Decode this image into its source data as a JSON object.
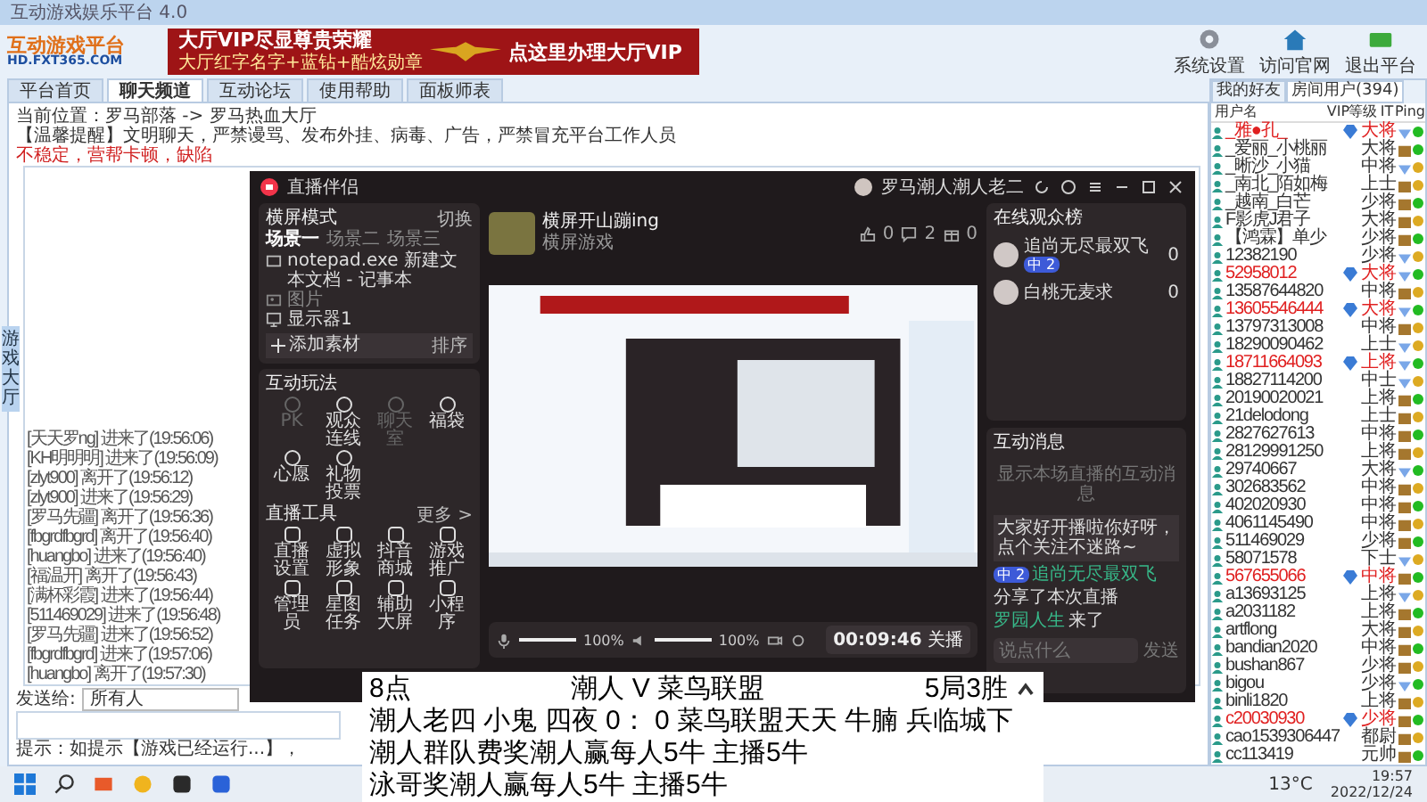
{
  "window": {
    "title": "互动游戏娱乐平台 4.0"
  },
  "banner": {
    "headline": "大厅VIP尽显尊贵荣耀",
    "subline": "大厅红字名字+蓝钻+酷炫勋章",
    "cta": "点这里办理大厅VIP"
  },
  "logo": {
    "name": "互动游戏平台",
    "url": "HD.FXT365.COM"
  },
  "toolbar": [
    {
      "label": "系统设置",
      "kind": "gear"
    },
    {
      "label": "访问官网",
      "kind": "house"
    },
    {
      "label": "退出平台",
      "kind": "exit"
    }
  ],
  "tabs": [
    {
      "label": "平台首页",
      "selected": false
    },
    {
      "label": "聊天频道",
      "selected": true
    },
    {
      "label": "互动论坛",
      "selected": false
    },
    {
      "label": "使用帮助",
      "selected": false
    },
    {
      "label": "面板师表",
      "selected": false
    }
  ],
  "breadcrumb": "当前位置：罗马部落 -> 罗马热血大厅",
  "notice": "【温馨提醒】文明聊天，严禁谩骂、发布外挂、病毒、广告，严禁冒充平台工作人员",
  "warning": "不稳定，营帮卡顿，缺陷",
  "side_tab": "游戏大厅",
  "chat_log": [
    {
      "user": "[天天罗ng]",
      "action": "进来了(19:56:06)"
    },
    {
      "user": "[KH明明明]",
      "action": "进来了(19:56:09)"
    },
    {
      "user": "[zlyt900]",
      "action": "离开了(19:56:12)"
    },
    {
      "user": "[zlyt900]",
      "action": "进来了(19:56:29)"
    },
    {
      "user": "[罗马先疆]",
      "action": "离开了(19:56:36)"
    },
    {
      "user": "[fbgrdfbgrd]",
      "action": "离开了(19:56:40)"
    },
    {
      "user": "[huangbo]",
      "action": "进来了(19:56:40)"
    },
    {
      "user": "[福温开]",
      "action": "离开了(19:56:43)"
    },
    {
      "user": "[满杯彩霞]",
      "action": "进来了(19:56:44)"
    },
    {
      "user": "[511469029]",
      "action": "进来了(19:56:48)"
    },
    {
      "user": "[罗马先疆]",
      "action": "进来了(19:56:52)"
    },
    {
      "user": "[fbgrdfbgrd]",
      "action": "进来了(19:57:06)"
    },
    {
      "user": "[huangbo]",
      "action": "离开了(19:57:30)"
    }
  ],
  "send": {
    "label": "发送给:",
    "target": "所有人"
  },
  "hint": "提示：如提示【游戏已经运行...】，",
  "users": {
    "tabs": [
      {
        "label": "我的好友",
        "selected": false
      },
      {
        "label": "房间用户(394)",
        "selected": true
      }
    ],
    "columns": [
      "用户名",
      "VIP",
      "等级",
      "IT",
      "Ping"
    ],
    "rows": [
      {
        "name": "_雅●孔_",
        "rank": "大将",
        "vip": true,
        "red": true,
        "kind": "gem",
        "color": "#22bb22"
      },
      {
        "name": "_爱丽_小桃丽",
        "rank": "大将",
        "vip": false,
        "red": false,
        "kind": "box",
        "color": "#22bb22"
      },
      {
        "name": "_晰沙_小猫",
        "rank": "中将",
        "vip": false,
        "red": false,
        "kind": "gem",
        "color": "#ddaa22"
      },
      {
        "name": "_南北_陌如梅",
        "rank": "上士",
        "vip": false,
        "red": false,
        "kind": "box",
        "color": "#ddaa22"
      },
      {
        "name": "_越南_白芒",
        "rank": "少将",
        "vip": false,
        "red": false,
        "kind": "box",
        "color": "#22bb22"
      },
      {
        "name": "F影虎J君子",
        "rank": "大将",
        "vip": false,
        "red": false,
        "kind": "box",
        "color": "#ddaa22"
      },
      {
        "name": "【鸿霖】单少",
        "rank": "少将",
        "vip": false,
        "red": false,
        "kind": "box",
        "color": "#22bb22"
      },
      {
        "name": "12382190",
        "rank": "少将",
        "vip": false,
        "red": false,
        "kind": "gem",
        "color": "#ddaa22"
      },
      {
        "name": "52958012",
        "rank": "大将",
        "vip": true,
        "red": true,
        "kind": "gem",
        "color": "#22bb22"
      },
      {
        "name": "13587644820",
        "rank": "中将",
        "vip": false,
        "red": false,
        "kind": "box",
        "color": "#ddaa22"
      },
      {
        "name": "13605546444",
        "rank": "大将",
        "vip": true,
        "red": true,
        "kind": "gem",
        "color": "#22bb22"
      },
      {
        "name": "13797313008",
        "rank": "中将",
        "vip": false,
        "red": false,
        "kind": "box",
        "color": "#ddaa22"
      },
      {
        "name": "18290090462",
        "rank": "上士",
        "vip": false,
        "red": false,
        "kind": "gem",
        "color": "#ddaa22"
      },
      {
        "name": "18711664093",
        "rank": "上将",
        "vip": true,
        "red": true,
        "kind": "gem",
        "color": "#22bb22"
      },
      {
        "name": "18827114200",
        "rank": "中士",
        "vip": false,
        "red": false,
        "kind": "gem",
        "color": "#ddaa22"
      },
      {
        "name": "20190020021",
        "rank": "上将",
        "vip": false,
        "red": false,
        "kind": "box",
        "color": "#22bb22"
      },
      {
        "name": "21delodong",
        "rank": "上士",
        "vip": false,
        "red": false,
        "kind": "box",
        "color": "#ddaa22"
      },
      {
        "name": "2827627613",
        "rank": "中将",
        "vip": false,
        "red": false,
        "kind": "box",
        "color": "#22bb22"
      },
      {
        "name": "28129991250",
        "rank": "上将",
        "vip": false,
        "red": false,
        "kind": "box",
        "color": "#ddaa22"
      },
      {
        "name": "29740667",
        "rank": "大将",
        "vip": false,
        "red": false,
        "kind": "gem",
        "color": "#22bb22"
      },
      {
        "name": "302683562",
        "rank": "中将",
        "vip": false,
        "red": false,
        "kind": "box",
        "color": "#ddaa22"
      },
      {
        "name": "402020930",
        "rank": "中将",
        "vip": false,
        "red": false,
        "kind": "box",
        "color": "#22bb22"
      },
      {
        "name": "4061145490",
        "rank": "中将",
        "vip": false,
        "red": false,
        "kind": "box",
        "color": "#ddaa22"
      },
      {
        "name": "511469029",
        "rank": "少将",
        "vip": false,
        "red": false,
        "kind": "box",
        "color": "#22bb22"
      },
      {
        "name": "58071578",
        "rank": "下士",
        "vip": false,
        "red": false,
        "kind": "gem",
        "color": "#ddaa22"
      },
      {
        "name": "567655066",
        "rank": "中将",
        "vip": true,
        "red": true,
        "kind": "box",
        "color": "#22bb22"
      },
      {
        "name": "a13693125",
        "rank": "上将",
        "vip": false,
        "red": false,
        "kind": "gem",
        "color": "#ddaa22"
      },
      {
        "name": "a2031182",
        "rank": "上将",
        "vip": false,
        "red": false,
        "kind": "box",
        "color": "#22bb22"
      },
      {
        "name": "artflong",
        "rank": "大将",
        "vip": false,
        "red": false,
        "kind": "box",
        "color": "#ddaa22"
      },
      {
        "name": "bandian2020",
        "rank": "中将",
        "vip": false,
        "red": false,
        "kind": "box",
        "color": "#22bb22"
      },
      {
        "name": "bushan867",
        "rank": "少将",
        "vip": false,
        "red": false,
        "kind": "box",
        "color": "#ddaa22"
      },
      {
        "name": "bigou",
        "rank": "少将",
        "vip": false,
        "red": false,
        "kind": "gem",
        "color": "#22bb22"
      },
      {
        "name": "binli1820",
        "rank": "上将",
        "vip": false,
        "red": false,
        "kind": "box",
        "color": "#ddaa22"
      },
      {
        "name": "c20030930",
        "rank": "少将",
        "vip": true,
        "red": true,
        "kind": "box",
        "color": "#22bb22"
      },
      {
        "name": "cao1539306447",
        "rank": "都尉",
        "vip": false,
        "red": false,
        "kind": "box",
        "color": "#ddaa22"
      },
      {
        "name": "cc113419",
        "rank": "元帅",
        "vip": false,
        "red": false,
        "kind": "box",
        "color": "#22bb22"
      }
    ]
  },
  "stream": {
    "app_name": "直播伴侣",
    "account": "罗马潮人潮人老二",
    "mode": "横屏模式",
    "switch": "切换",
    "scenes": [
      {
        "label": "场景一",
        "selected": true
      },
      {
        "label": "场景二",
        "selected": false
      },
      {
        "label": "场景三",
        "selected": false
      }
    ],
    "sources": [
      {
        "label": "notepad.exe 新建文本文档 - 记事本",
        "kind": "window"
      },
      {
        "label": "图片",
        "kind": "image"
      },
      {
        "label": "显示器1",
        "kind": "monitor"
      }
    ],
    "add_source": "添加素材",
    "sort": "排序",
    "interact_title": "互动玩法",
    "interact": [
      {
        "label": "PK",
        "disabled": true
      },
      {
        "label": "观众连线",
        "disabled": false
      },
      {
        "label": "聊天室",
        "disabled": true
      },
      {
        "label": "福袋",
        "disabled": false
      },
      {
        "label": "心愿",
        "disabled": false
      },
      {
        "label": "礼物投票",
        "disabled": false
      }
    ],
    "tools_title": "直播工具",
    "tools_more": "更多 >",
    "tools": [
      "直播设置",
      "虚拟形象",
      "抖音商城",
      "游戏推广",
      "管理员",
      "星图任务",
      "辅助大屏",
      "小程序"
    ],
    "room_title": "横屏开山蹦ing",
    "room_sub": "横屏游戏",
    "stats": [
      {
        "kind": "like",
        "value": "0"
      },
      {
        "kind": "comment",
        "value": "2"
      },
      {
        "kind": "gift",
        "value": "0"
      }
    ],
    "mic": {
      "level": 1,
      "reading": "100%"
    },
    "speaker": {
      "level": 1,
      "reading": "100%"
    },
    "timer": "00:09:46",
    "stop": "关播",
    "viewers_title": "在线观众榜",
    "viewers": [
      {
        "name": "追尚无尽最双飞",
        "badge": "中 2",
        "score": "0"
      },
      {
        "name": "白桃无麦求",
        "score": "0"
      }
    ],
    "messages_title": "互动消息",
    "messages_empty": "显示本场直播的互动消息",
    "greeting": "大家好开播啦你好呀，点个关注不迷路~",
    "events": [
      {
        "user": "追尚无尽最双飞",
        "badge": "中 2",
        "text": "分享了本次直播"
      },
      {
        "user": "罗园人生",
        "text": "来了"
      }
    ],
    "input_placeholder": "说点什么",
    "send": "发送"
  },
  "overlay": {
    "lines": [
      [
        "8点",
        "潮人 V 菜鸟联盟",
        "5局3胜"
      ],
      [
        "潮人老四 小鬼 四夜 0： 0 菜鸟联盟天天 牛腩 兵临城下"
      ],
      [
        "潮人群队费奖潮人赢每人5牛 主播5牛"
      ],
      [
        "泳哥奖潮人赢每人5牛 主播5牛"
      ]
    ]
  },
  "taskbar": {
    "weather": "13°C",
    "time": "19:57",
    "date": "2022/12/24"
  }
}
